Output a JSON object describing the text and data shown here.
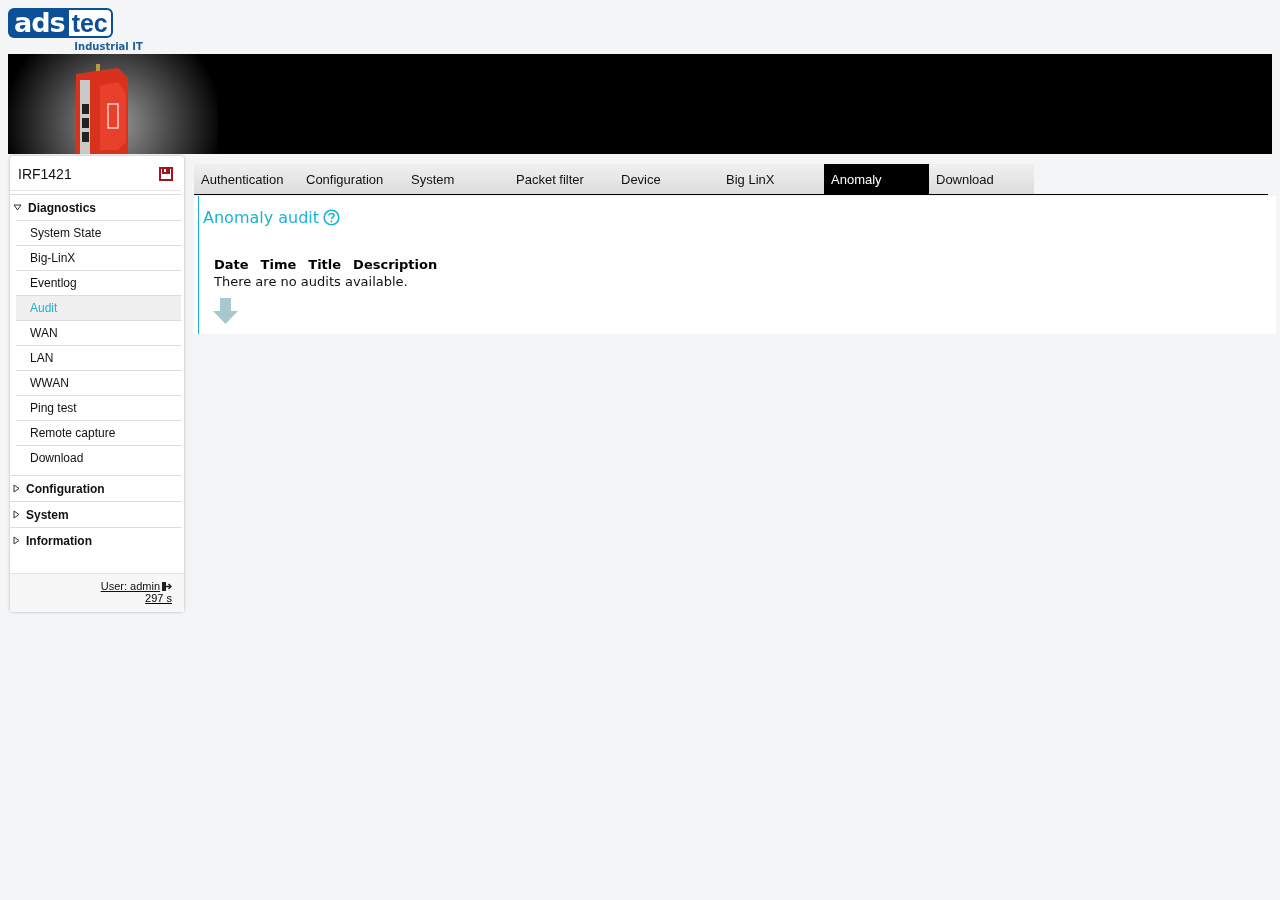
{
  "logo": {
    "left": "ads",
    "right": "tec",
    "tagline": "Industrial IT"
  },
  "sidebar": {
    "device": "IRF1421",
    "sections": [
      {
        "label": "Diagnostics",
        "expanded": true,
        "items": [
          {
            "label": "System State",
            "selected": false
          },
          {
            "label": "Big-LinX",
            "selected": false
          },
          {
            "label": "Eventlog",
            "selected": false
          },
          {
            "label": "Audit",
            "selected": true
          },
          {
            "label": "WAN",
            "selected": false
          },
          {
            "label": "LAN",
            "selected": false
          },
          {
            "label": "WWAN",
            "selected": false
          },
          {
            "label": "Ping test",
            "selected": false
          },
          {
            "label": "Remote capture",
            "selected": false
          },
          {
            "label": "Download",
            "selected": false
          }
        ]
      },
      {
        "label": "Configuration",
        "expanded": false
      },
      {
        "label": "System",
        "expanded": false
      },
      {
        "label": "Information",
        "expanded": false
      }
    ],
    "user": "User: admin",
    "timeout": "297 s"
  },
  "tabs": [
    {
      "label": "Authentication",
      "selected": false
    },
    {
      "label": "Configuration",
      "selected": false
    },
    {
      "label": "System",
      "selected": false
    },
    {
      "label": "Packet filter",
      "selected": false
    },
    {
      "label": "Device",
      "selected": false
    },
    {
      "label": "Big LinX",
      "selected": false
    },
    {
      "label": "Anomaly",
      "selected": true
    },
    {
      "label": "Download",
      "selected": false
    }
  ],
  "panel": {
    "title": "Anomaly audit",
    "columns": [
      "Date",
      "Time",
      "Title",
      "Description"
    ],
    "empty_message": "There are no audits available."
  }
}
